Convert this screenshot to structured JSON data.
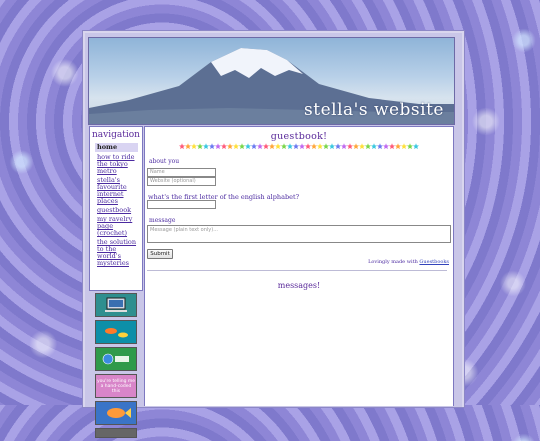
{
  "site": {
    "title": "stella's website"
  },
  "nav": {
    "title": "navigation",
    "items": [
      {
        "label": "home"
      },
      {
        "label": "how to ride the tokyo metro"
      },
      {
        "label": "stella's favourite internet places"
      },
      {
        "label": "guestbook"
      },
      {
        "label": "my ravelry page (crochet)"
      },
      {
        "label": "the solution to the world's mysteries"
      }
    ]
  },
  "buttons": [
    {
      "name": "pc-button",
      "color": "#2f8f8f"
    },
    {
      "name": "aquarium-button",
      "color": "#0d8fa8"
    },
    {
      "name": "world-button",
      "color": "#2f9a4a"
    },
    {
      "name": "youre-telling-me-button",
      "text": "you're telling me a hand-coded this",
      "color": "#d885c9"
    },
    {
      "name": "fish-button",
      "color": "#3a74c7"
    },
    {
      "name": "gray-button",
      "color": "#666666"
    }
  ],
  "guestbook": {
    "title": "guestbook!",
    "about_label": "about you",
    "name_placeholder": "Name",
    "website_placeholder": "Website (optional)",
    "question": "what's the first letter of the english alphabet?",
    "message_label": "message",
    "message_placeholder": "Message (plain text only)...",
    "submit_label": "Submit",
    "credit_text": "Lovingly made with ",
    "credit_link": "Guestbooks",
    "messages_title": "messages!"
  },
  "colors": {
    "accent": "#5a2a9a",
    "link": "#4b2aa0",
    "background": "#9a93dd"
  }
}
